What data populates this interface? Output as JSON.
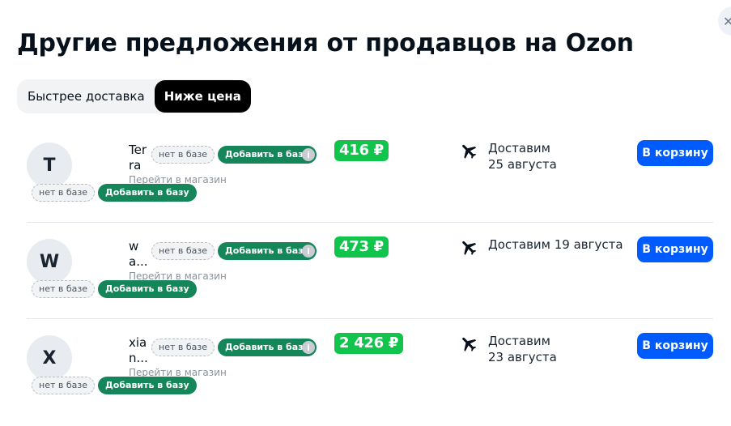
{
  "close_icon": "close-icon",
  "title": "Другие предложения от продавцов на Ozon",
  "tabs": [
    {
      "label": "Быстрее доставка",
      "active": false
    },
    {
      "label": "Ниже цена",
      "active": true
    }
  ],
  "colors": {
    "price_green": "#10c44c",
    "cart_blue": "#005bff",
    "chip_green": "#15855a",
    "active_tab": "#000000"
  },
  "offers": [
    {
      "avatar_letter": "T",
      "seller_name": "Terra",
      "not_in_db": "нет в базе",
      "add_to_db": "Добавить в базу",
      "store_link": "Перейти в магазин",
      "price": "416 ₽",
      "delivery": "Доставим\n25 августа",
      "cart_button": "В корзину"
    },
    {
      "avatar_letter": "W",
      "seller_name": "wa...",
      "not_in_db": "нет в базе",
      "add_to_db": "Добавить в базу",
      "store_link": "Перейти в магазин",
      "price": "473 ₽",
      "delivery": "Доставим 19 августа",
      "cart_button": "В корзину"
    },
    {
      "avatar_letter": "X",
      "seller_name": "xian...",
      "not_in_db": "нет в базе",
      "add_to_db": "Добавить в базу",
      "store_link": "Перейти в магазин",
      "price": "2 426 ₽",
      "delivery": "Доставим\n23 августа",
      "cart_button": "В корзину"
    }
  ]
}
